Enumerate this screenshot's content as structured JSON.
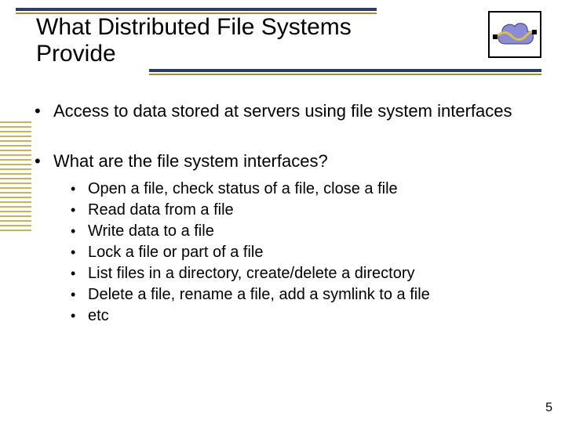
{
  "title": "What Distributed File Systems Provide",
  "bullets": [
    {
      "text": "Access to data stored at servers using file system interfaces",
      "sub": []
    },
    {
      "text": "What are the file system interfaces?",
      "sub": [
        "Open a file, check status of a file, close a file",
        "Read data from a file",
        "Write data to a file",
        "Lock a file or part of a file",
        "List files in a directory, create/delete a directory",
        "Delete a file, rename a file, add a symlink to a file",
        "etc"
      ]
    }
  ],
  "page_number": "5"
}
